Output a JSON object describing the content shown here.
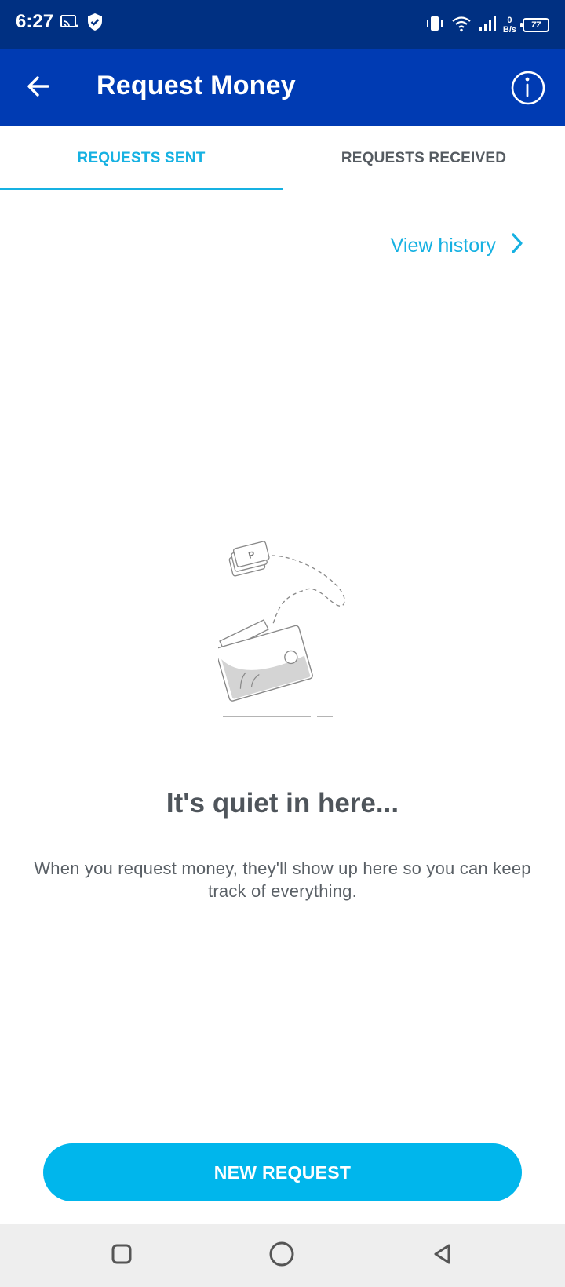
{
  "status_bar": {
    "time": "6:27",
    "net_speed_value": "0",
    "net_speed_unit": "B/s",
    "battery": "77",
    "icons": [
      "screen-cast-icon",
      "shield-check-icon",
      "vibrate-icon",
      "wifi-icon",
      "signal-icon",
      "battery-icon"
    ]
  },
  "app_bar": {
    "title": "Request Money",
    "icons": [
      "back-arrow-icon",
      "info-icon"
    ]
  },
  "tabs": [
    {
      "label": "REQUESTS SENT",
      "active": true
    },
    {
      "label": "REQUESTS RECEIVED",
      "active": false
    }
  ],
  "view_history": {
    "label": "View history",
    "icon": "chevron-right-icon"
  },
  "empty_state": {
    "illustration": "wallet-with-flying-card-illustration",
    "card_letter": "P",
    "title": "It's quiet in here...",
    "description": "When you request money, they'll show up here so you can keep track of everything."
  },
  "primary_action": {
    "label": "NEW REQUEST"
  },
  "nav_bar": {
    "icons": [
      "recents-square-icon",
      "home-circle-icon",
      "back-triangle-icon"
    ]
  },
  "colors": {
    "status_bar": "#003082",
    "app_bar": "#003bb3",
    "accent": "#16b1e2",
    "button": "#00b6ec",
    "text_dark": "#4f555b",
    "nav_bar": "#eeeeee"
  }
}
